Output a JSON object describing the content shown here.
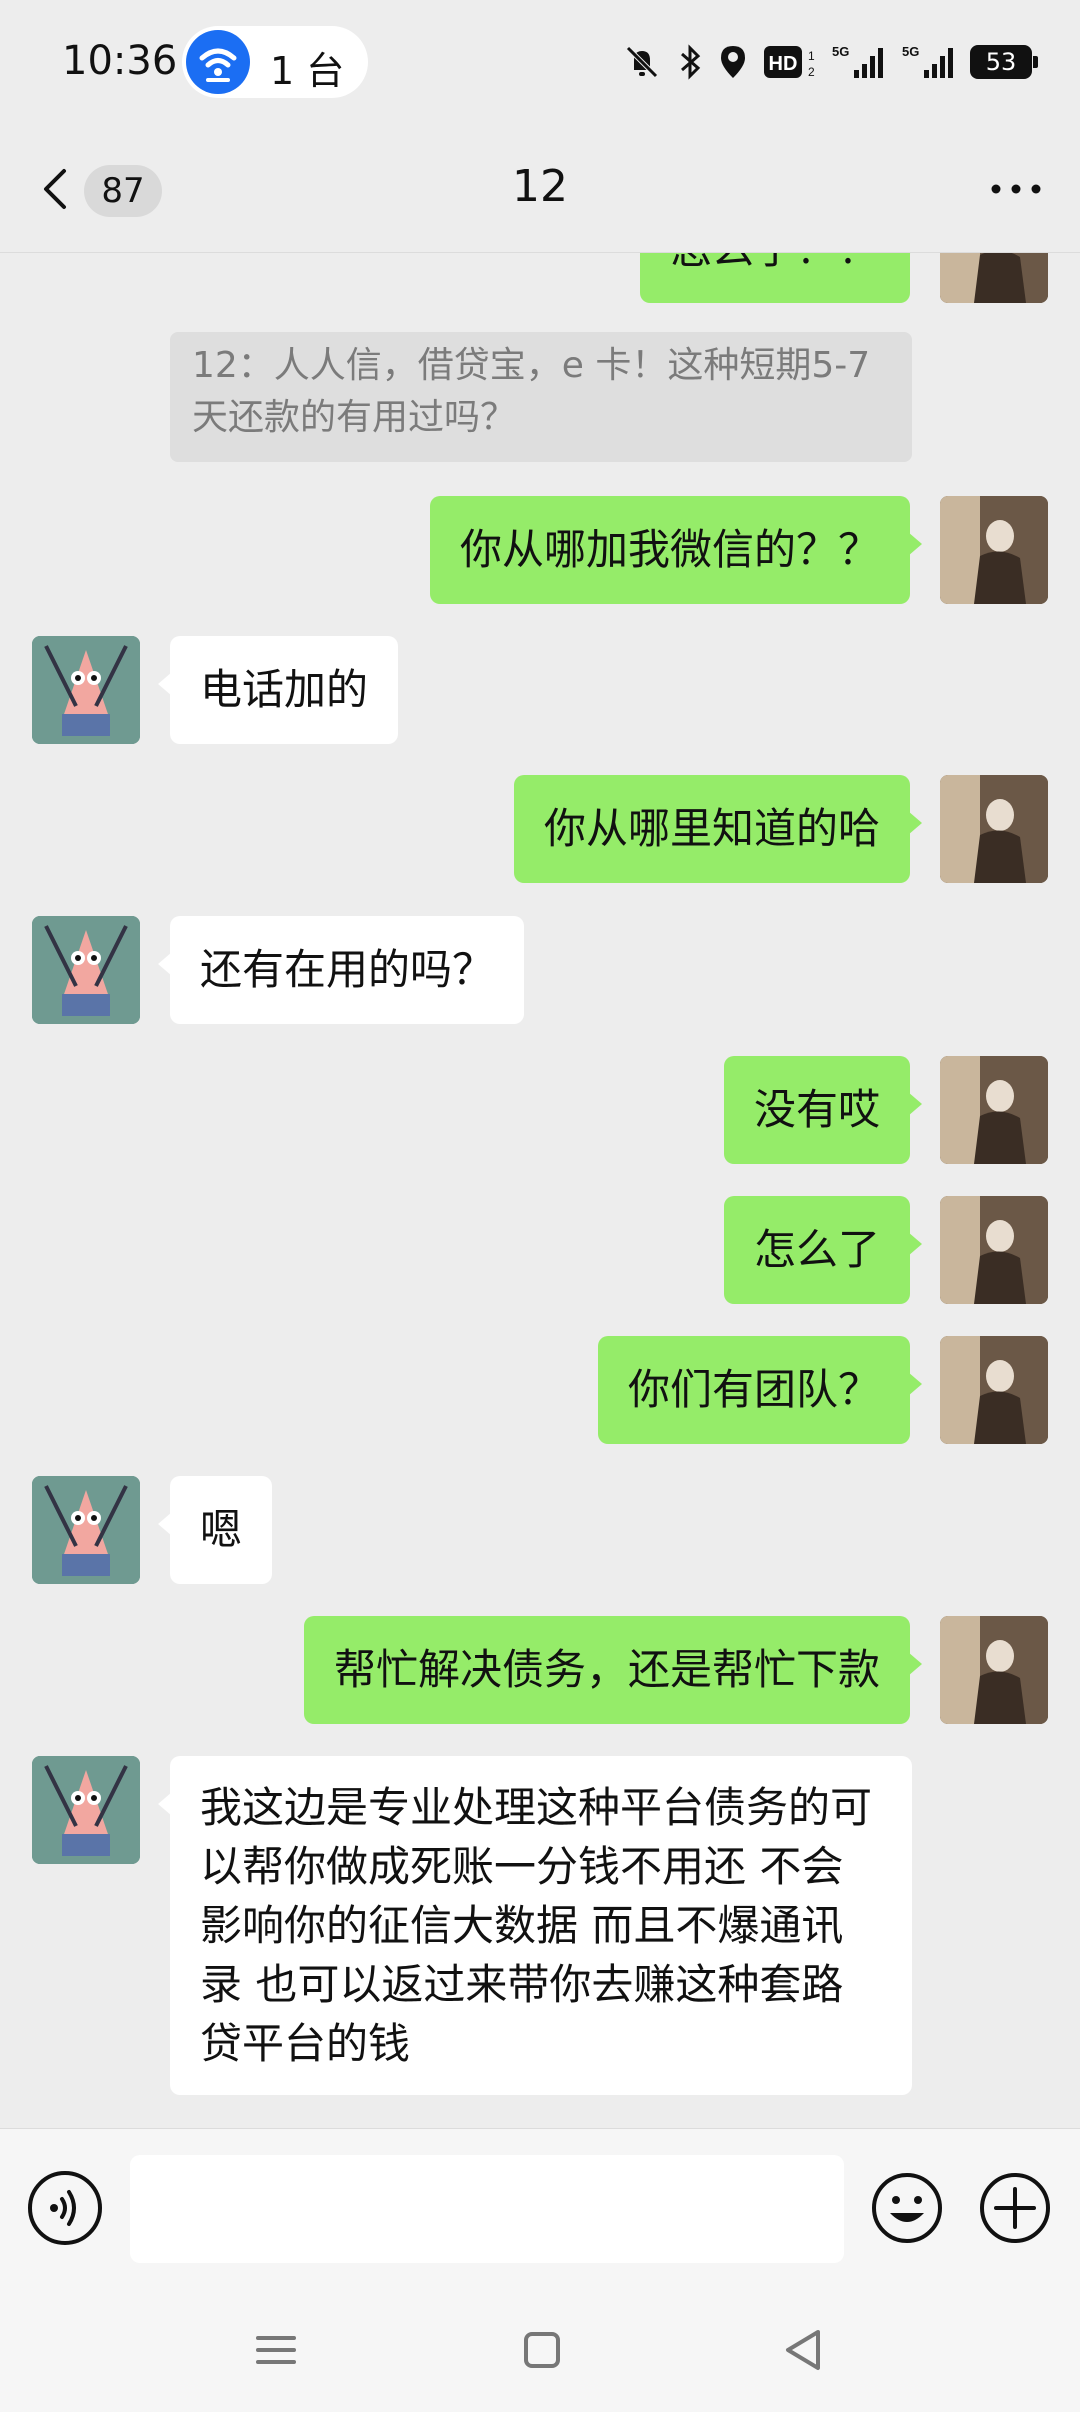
{
  "status_bar": {
    "time": "10:36",
    "hotspot_label": "1 台",
    "battery": "53",
    "icons": [
      "mute-icon",
      "bluetooth-icon",
      "location-icon",
      "hd-icon",
      "5g-signal-icon",
      "5g-signal-icon",
      "battery-icon"
    ]
  },
  "header": {
    "back_badge": "87",
    "title": "12",
    "more_icon": "more-icon"
  },
  "messages": [
    {
      "side": "sent",
      "text": "怎么了？？"
    },
    {
      "side": "quote",
      "text": "12：人人信，借贷宝，e 卡！这种短期5-7 天还款的有用过吗？"
    },
    {
      "side": "sent",
      "text": "你从哪加我微信的？？"
    },
    {
      "side": "recv",
      "text": "电话加的"
    },
    {
      "side": "sent",
      "text": "你从哪里知道的哈"
    },
    {
      "side": "recv",
      "text": "还有在用的吗？"
    },
    {
      "side": "sent",
      "text": "没有哎"
    },
    {
      "side": "sent",
      "text": "怎么了"
    },
    {
      "side": "sent",
      "text": "你们有团队？"
    },
    {
      "side": "recv",
      "text": "嗯"
    },
    {
      "side": "sent",
      "text": "帮忙解决债务，还是帮忙下款"
    },
    {
      "side": "recv",
      "text": "我这边是专业处理这种平台债务的可以帮你做成死账一分钱不用还 不会影响你的征信大数据 而且不爆通讯录  也可以返过来带你去赚这种套路贷平台的钱"
    }
  ],
  "input_bar": {
    "placeholder": "",
    "voice_icon": "voice-icon",
    "emoji_icon": "emoji-icon",
    "plus_icon": "plus-icon"
  },
  "nav_bar": {
    "icons": [
      "menu-icon",
      "home-icon",
      "back-icon"
    ]
  },
  "colors": {
    "sent_bubble": "#95ec69",
    "recv_bubble": "#ffffff",
    "background": "#ededed",
    "hotspot_accent": "#1b6ef3"
  }
}
